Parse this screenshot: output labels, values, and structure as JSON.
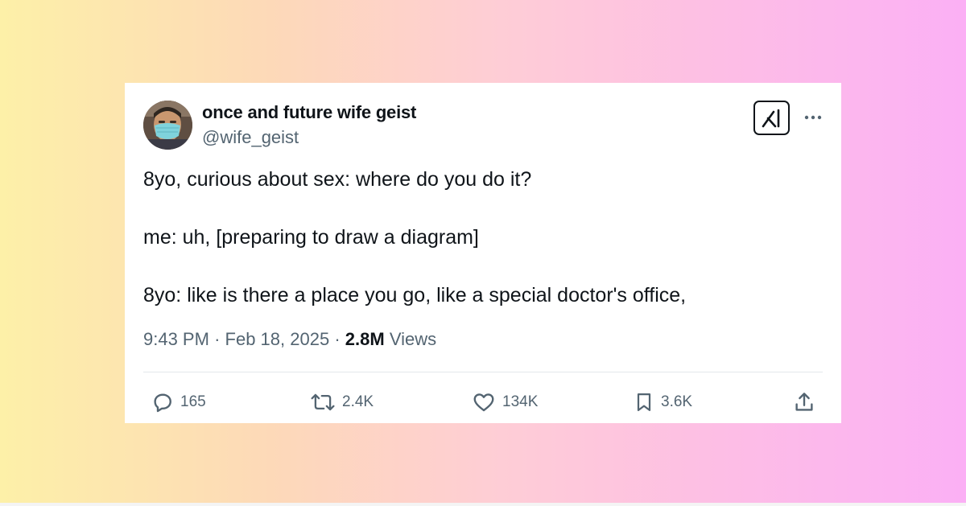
{
  "tweet": {
    "display_name": "once and future wife geist",
    "handle": "@wife_geist",
    "lines": [
      "8yo, curious about sex: where do you do it?",
      "me: uh, [preparing to draw a diagram]",
      "8yo: like is there a place you go, like a special doctor's office,"
    ],
    "time": "9:43 PM",
    "date": "Feb 18, 2025",
    "views_count": "2.8M",
    "views_label": "Views"
  },
  "actions": {
    "replies": "165",
    "reposts": "2.4K",
    "likes": "134K",
    "bookmarks": "3.6K"
  },
  "icons": {
    "grok": "grok-icon",
    "more": "more-icon",
    "reply": "reply-icon",
    "repost": "repost-icon",
    "like": "heart-icon",
    "bookmark": "bookmark-icon",
    "share": "share-icon"
  },
  "colors": {
    "text_primary": "#0f1419",
    "text_secondary": "#536471",
    "background_left": "#fdf0a8",
    "background_right": "#fbb0f5"
  }
}
